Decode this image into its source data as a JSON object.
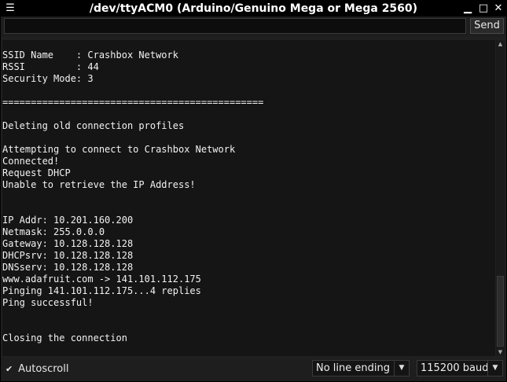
{
  "window": {
    "title": "/dev/ttyACM0 (Arduino/Genuino Mega or Mega 2560)",
    "menu_glyph": "☰",
    "min_glyph": "▁",
    "max_glyph": "□",
    "close_glyph": "✕"
  },
  "input": {
    "value": "",
    "placeholder": ""
  },
  "send_button": {
    "label": "Send"
  },
  "console_lines": [
    "SSID Name    : Crashbox Network",
    "RSSI         : 44",
    "Security Mode: 3",
    "",
    "==============================================",
    "",
    "Deleting old connection profiles",
    "",
    "Attempting to connect to Crashbox Network",
    "Connected!",
    "Request DHCP",
    "Unable to retrieve the IP Address!",
    "",
    "",
    "IP Addr: 10.201.160.200",
    "Netmask: 255.0.0.0",
    "Gateway: 10.128.128.128",
    "DHCPsrv: 10.128.128.128",
    "DNSserv: 10.128.128.128",
    "www.adafruit.com -> 141.101.112.175",
    "Pinging 141.101.112.175...4 replies",
    "Ping successful!",
    "",
    "",
    "Closing the connection"
  ],
  "autoscroll": {
    "label": "Autoscroll",
    "checked": true,
    "check_glyph": "✔"
  },
  "line_ending": {
    "selected": "No line ending",
    "arrow_glyph": "▼"
  },
  "baud": {
    "selected": "115200 baud",
    "arrow_glyph": "▼"
  }
}
